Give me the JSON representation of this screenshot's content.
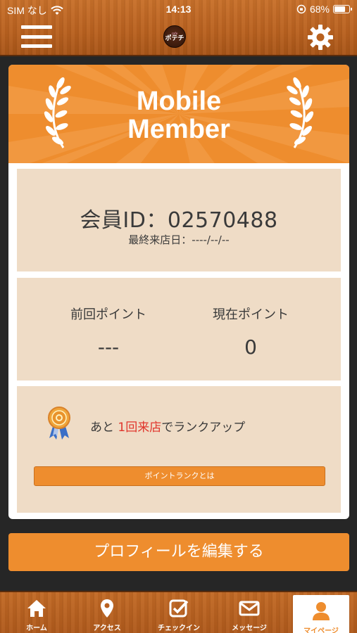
{
  "status_bar": {
    "carrier": "SIM なし",
    "time": "14:13",
    "battery": "68%"
  },
  "banner": {
    "title_line1": "Mobile",
    "title_line2": "Member"
  },
  "member": {
    "id_text": "会員ID：02570488",
    "last_visit": "最終来店日：----/--/--"
  },
  "points": {
    "previous_label": "前回ポイント",
    "previous_value": "---",
    "current_label": "現在ポイント",
    "current_value": "0"
  },
  "rank": {
    "prefix": "あと ",
    "highlight": "1回来店",
    "suffix": "でランクアップ",
    "button_label": "ポイントランクとは"
  },
  "edit_profile_label": "プロフィールを編集する",
  "logo": {
    "top": "cafe",
    "main": "ポテチ"
  },
  "tabs": [
    {
      "label": "ホーム",
      "icon": "home-icon"
    },
    {
      "label": "アクセス",
      "icon": "location-pin-icon"
    },
    {
      "label": "チェックイン",
      "icon": "checkin-icon"
    },
    {
      "label": "メッセージ",
      "icon": "message-icon"
    },
    {
      "label": "マイページ",
      "icon": "user-icon"
    }
  ],
  "colors": {
    "accent": "#ee8d2e",
    "panel": "#efdcc6",
    "highlight": "#e0352c"
  }
}
